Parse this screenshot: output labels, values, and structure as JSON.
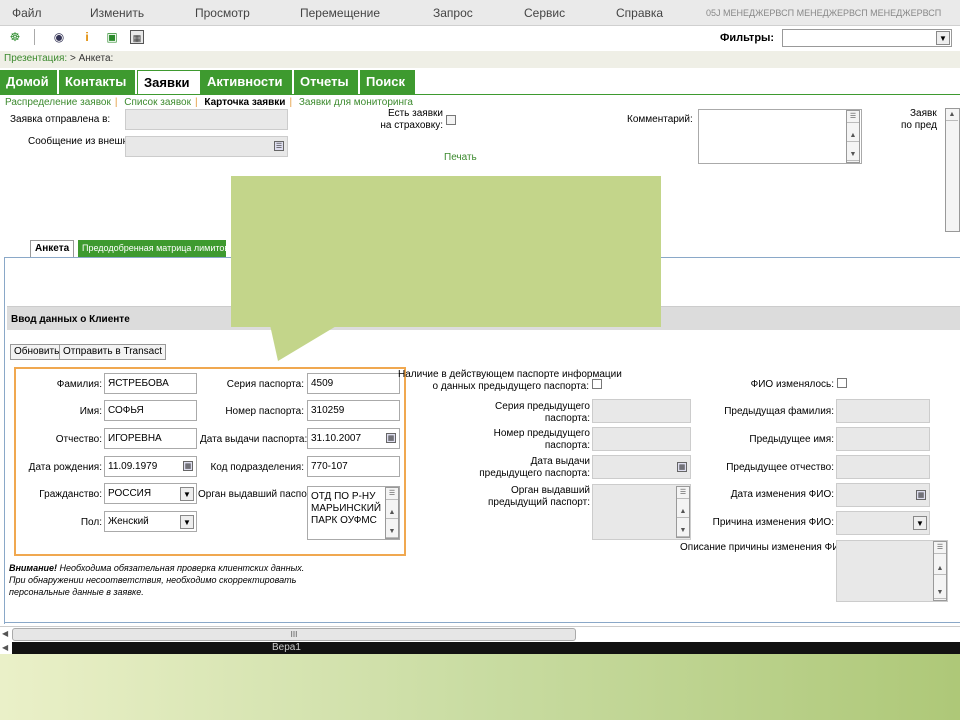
{
  "menu": {
    "items": [
      "Файл",
      "Изменить",
      "Просмотр",
      "Перемещение",
      "Запрос",
      "Сервис",
      "Справка"
    ],
    "user": "05J МЕНЕДЖЕРВСП МЕНЕДЖЕРВСП МЕНЕДЖЕРВСП"
  },
  "toolbar": {
    "filters_label": "Фильтры:",
    "icons": [
      "hierarchy-icon",
      "binoculars-icon",
      "info-icon",
      "document-icon",
      "calculator-icon"
    ]
  },
  "breadcrumb": {
    "prefix": "Презентация:",
    "path": "> Анкета:"
  },
  "main_tabs": [
    "Домой",
    "Контакты",
    "Заявки",
    "Активности",
    "Отчеты",
    "Поиск"
  ],
  "active_main_tab": "Заявки",
  "sub_tabs": [
    "Распределение заявок",
    "Список заявок",
    "Карточка заявки",
    "Заявки для мониторинга"
  ],
  "header_form": {
    "sent_to_label": "Заявка отправлена в:",
    "ext_msg_label": "Сообщение из внешней системы:",
    "insurance_label_1": "Есть заявки",
    "insurance_label_2": "на страховку:",
    "print_link": "Печать",
    "comment_label": "Комментарий:",
    "right_cut_1": "Заявк",
    "right_cut_2": "по пред"
  },
  "form_tabs": [
    "Анкета",
    "Предодобренная матрица лимитов"
  ],
  "section": {
    "title": "Ввод данных о Клиенте",
    "refresh_btn": "Обновить",
    "send_btn": "Отправить в Transact"
  },
  "client": {
    "surname_label": "Фамилия:",
    "surname": "ЯСТРЕБОВА",
    "name_label": "Имя:",
    "name": "СОФЬЯ",
    "patronymic_label": "Отчество:",
    "patronymic": "ИГОРЕВНА",
    "birth_label": "Дата рождения:",
    "birth": "11.09.1979",
    "citizenship_label": "Гражданство:",
    "citizenship": "РОССИЯ",
    "gender_label": "Пол:",
    "gender": "Женский"
  },
  "passport": {
    "series_label": "Серия паспорта:",
    "series": "4509",
    "number_label": "Номер паспорта:",
    "number": "310259",
    "issue_date_label": "Дата выдачи паспорта:",
    "issue_date": "31.10.2007",
    "dept_code_label": "Код подразделения:",
    "dept_code": "770-107",
    "issuer_label": "Орган выдавший паспорт:",
    "issuer_lines": [
      "ОТД ПО Р-НУ",
      "МАРЬИНСКИЙ",
      "ПАРК ОУФМС"
    ]
  },
  "prev_passport": {
    "info_label_1": "Наличие в действующем паспорте информации",
    "info_label_2": "о данных предыдущего паспорта:",
    "series_label_1": "Серия предыдущего",
    "series_label_2": "паспорта:",
    "number_label_1": "Номер предыдущего",
    "number_label_2": "паспорта:",
    "date_label_1": "Дата выдачи",
    "date_label_2": "предыдущего паспорта:",
    "issuer_label_1": "Орган выдавший",
    "issuer_label_2": "предыдущий паспорт:"
  },
  "fio_change": {
    "changed_label": "ФИО изменялось:",
    "prev_surname_label": "Предыдущая фамилия:",
    "prev_name_label": "Предыдущее имя:",
    "prev_patronymic_label": "Предыдущее отчество:",
    "change_date_label": "Дата изменения ФИО:",
    "reason_label": "Причина изменения ФИО:",
    "reason_desc_label": "Описание причины изменения ФИО:"
  },
  "warning": {
    "bold": "Внимание!",
    "line1": " Необходима обязательная проверка клиентских данных.",
    "line2": "При обнаружении несоответствия, необходимо скорректировать",
    "line3": "персональные данные в заявке."
  },
  "bottom": {
    "scroll_grip": "III",
    "dark_text": "Вера1"
  },
  "colors": {
    "accent": "#3e9a2f",
    "callout": "#c3d58a",
    "highlight_box": "#f0a850"
  }
}
